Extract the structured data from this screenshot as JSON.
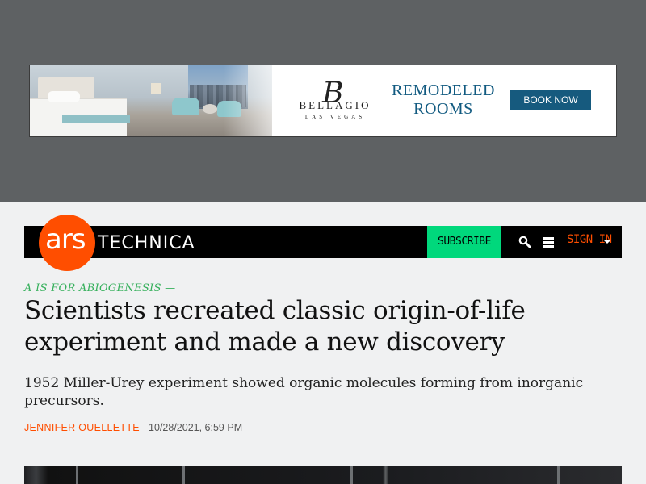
{
  "ad": {
    "logo_initial": "B",
    "logo_word": "BELLAGIO",
    "logo_city": "LAS VEGAS",
    "headline_line1": "REMODELED",
    "headline_line2": "ROOMS",
    "cta": "BOOK NOW"
  },
  "header": {
    "logo_ars": "ars",
    "logo_technica": "TECHNICA",
    "subscribe": "SUBSCRIBE",
    "signin": "SIGN IN",
    "colors": {
      "brand": "#ff4e00",
      "subscribe_bg": "#00d87c",
      "bar": "#000000"
    }
  },
  "article": {
    "kicker": "A IS FOR ABIOGENESIS —",
    "title": "Scientists recreated classic origin-of-life experiment and made a new discovery",
    "dek": "1952 Miller-Urey experiment showed organic molecules forming from inorganic precursors.",
    "author": "JENNIFER OUELLETTE",
    "separator": " - ",
    "date": "10/28/2021, 6:59 PM"
  }
}
